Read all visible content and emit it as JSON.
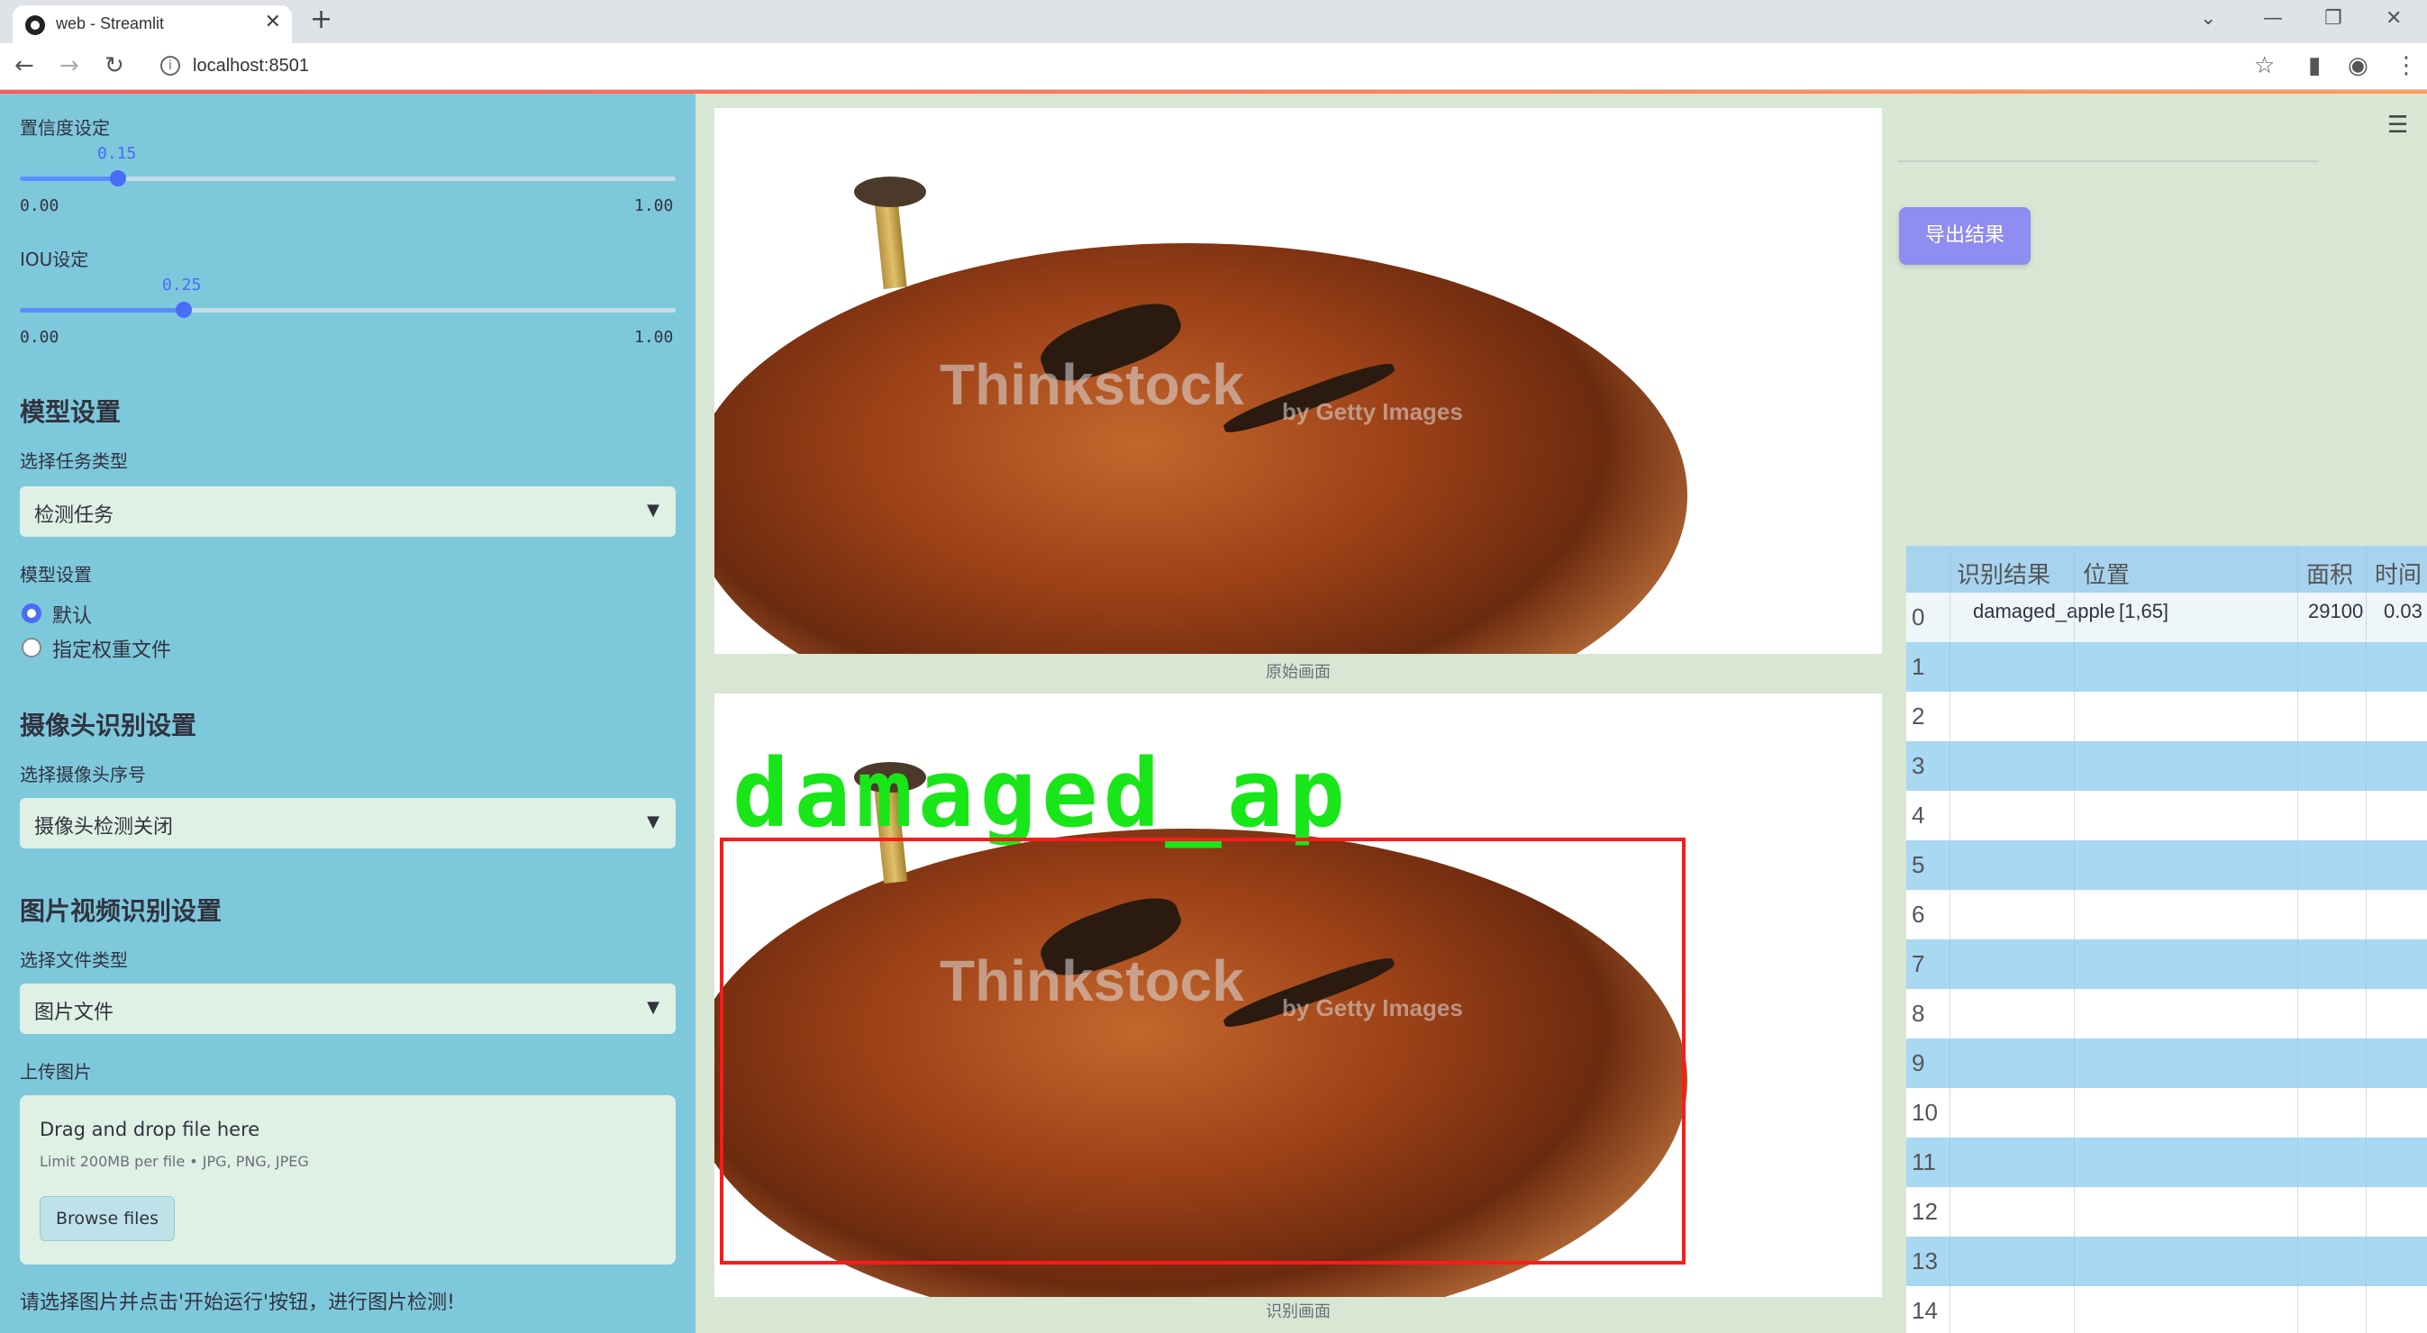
{
  "browser": {
    "tab_title": "web - Streamlit",
    "url": "localhost:8501",
    "new_tab": "+",
    "close": "✕"
  },
  "sidebar": {
    "confidence": {
      "label": "置信度设定",
      "value": "0.15",
      "level": 0.15,
      "min": "0.00",
      "max": "1.00"
    },
    "iou": {
      "label": "IOU设定",
      "value": "0.25",
      "level": 0.25,
      "min": "0.00",
      "max": "1.00"
    },
    "model_heading": "模型设置",
    "task_label": "选择任务类型",
    "task_value": "检测任务",
    "model_label": "模型设置",
    "radio_default": "默认",
    "radio_custom": "指定权重文件",
    "camera_heading": "摄像头识别设置",
    "camera_label": "选择摄像头序号",
    "camera_value": "摄像头检测关闭",
    "media_heading": "图片视频识别设置",
    "filetype_label": "选择文件类型",
    "filetype_value": "图片文件",
    "upload_label": "上传图片",
    "upload_title": "Drag and drop file here",
    "upload_limit": "Limit 200MB per file • JPG, PNG, JPEG",
    "browse_button": "Browse files",
    "footer": "请选择图片并点击'开始运行'按钮，进行图片检测!"
  },
  "main": {
    "original_caption": "原始画面",
    "result_caption": "识别画面",
    "watermark": "Thinkstock",
    "watermark_sub": "by Getty Images",
    "detection_label": "damaged_ap"
  },
  "right": {
    "export_button": "导出结果",
    "table": {
      "headers": [
        "识别结果",
        "位置",
        "面积",
        "时间"
      ],
      "row0": {
        "index": "0",
        "result": "damaged_apple",
        "position": "[1,65]",
        "area": "29100",
        "time": "0.03"
      },
      "indices": [
        "1",
        "2",
        "3",
        "4",
        "5",
        "6",
        "7",
        "8",
        "9",
        "10",
        "11",
        "12",
        "13",
        "14"
      ]
    }
  },
  "colors": {
    "sidebar": "#7ec8dc",
    "accent": "#4a6cf7",
    "detect_box": "#ff1a1a",
    "detect_label": "#19e619",
    "export": "#8f8cf2"
  }
}
